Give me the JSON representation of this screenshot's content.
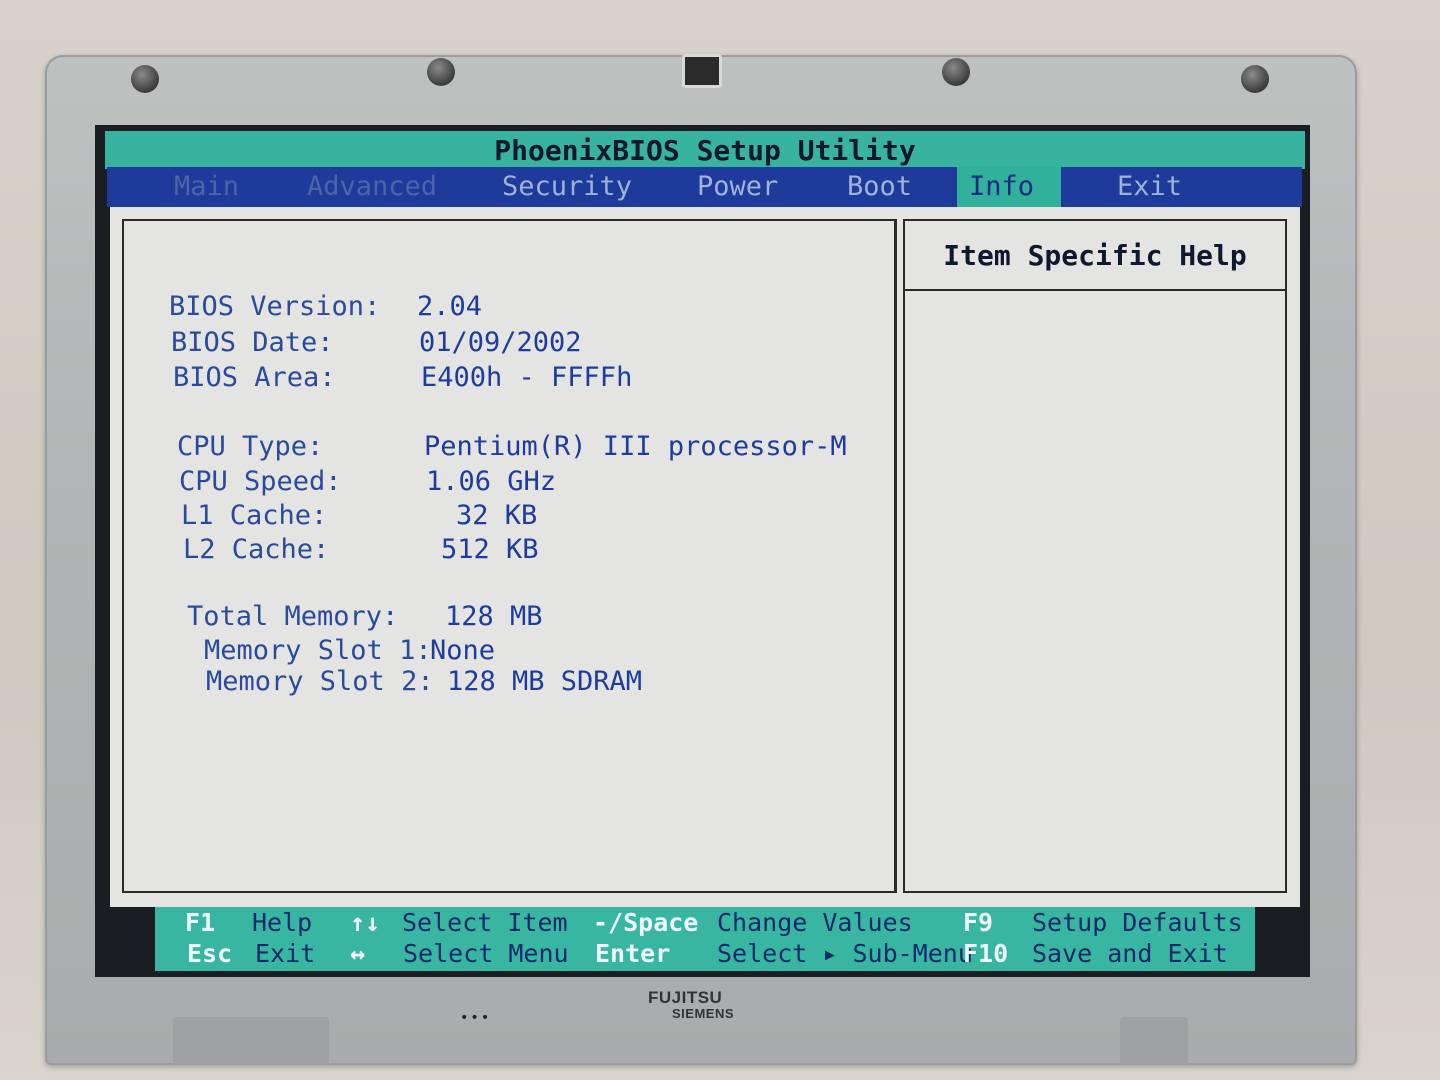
{
  "title": "PhoenixBIOS Setup Utility",
  "menu": [
    {
      "label": "Main",
      "state": "disabled"
    },
    {
      "label": "Advanced",
      "state": "disabled"
    },
    {
      "label": "Security",
      "state": "normal"
    },
    {
      "label": "Power",
      "state": "normal"
    },
    {
      "label": "Boot",
      "state": "normal"
    },
    {
      "label": "Info",
      "state": "active"
    },
    {
      "label": "Exit",
      "state": "normal"
    }
  ],
  "info": {
    "bios_version": {
      "label": "BIOS Version:",
      "value": "2.04"
    },
    "bios_date": {
      "label": "BIOS Date:",
      "value": "01/09/2002"
    },
    "bios_area": {
      "label": "BIOS Area:",
      "value": "E400h - FFFFh"
    },
    "cpu_type": {
      "label": "CPU Type:",
      "value": "Pentium(R) III processor-M"
    },
    "cpu_speed": {
      "label": "CPU Speed:",
      "value": "1.06 GHz"
    },
    "l1_cache": {
      "label": "L1 Cache:",
      "value": "32 KB"
    },
    "l2_cache": {
      "label": "L2 Cache:",
      "value": "512 KB"
    },
    "total_memory": {
      "label": "Total Memory:",
      "value": "128 MB"
    },
    "memory_slot_1": {
      "label": "Memory Slot 1:",
      "value": "None"
    },
    "memory_slot_2": {
      "label": "Memory Slot 2:",
      "value": "128 MB SDRAM"
    }
  },
  "help": {
    "title": "Item Specific Help"
  },
  "footer": [
    {
      "key": "F1",
      "desc": "Help"
    },
    {
      "key": "↑↓",
      "desc": "Select Item"
    },
    {
      "key": "-/Space",
      "desc": "Change Values"
    },
    {
      "key": "F9",
      "desc": "Setup Defaults"
    },
    {
      "key": "Esc",
      "desc": "Exit"
    },
    {
      "key": "↔",
      "desc": "Select Menu"
    },
    {
      "key": "Enter",
      "desc": "Select ▸ Sub-Menu"
    },
    {
      "key": "F10",
      "desc": "Save and Exit"
    }
  ],
  "bezel": {
    "brand_line1": "FUJITSU",
    "brand_line2": "SIEMENS"
  }
}
